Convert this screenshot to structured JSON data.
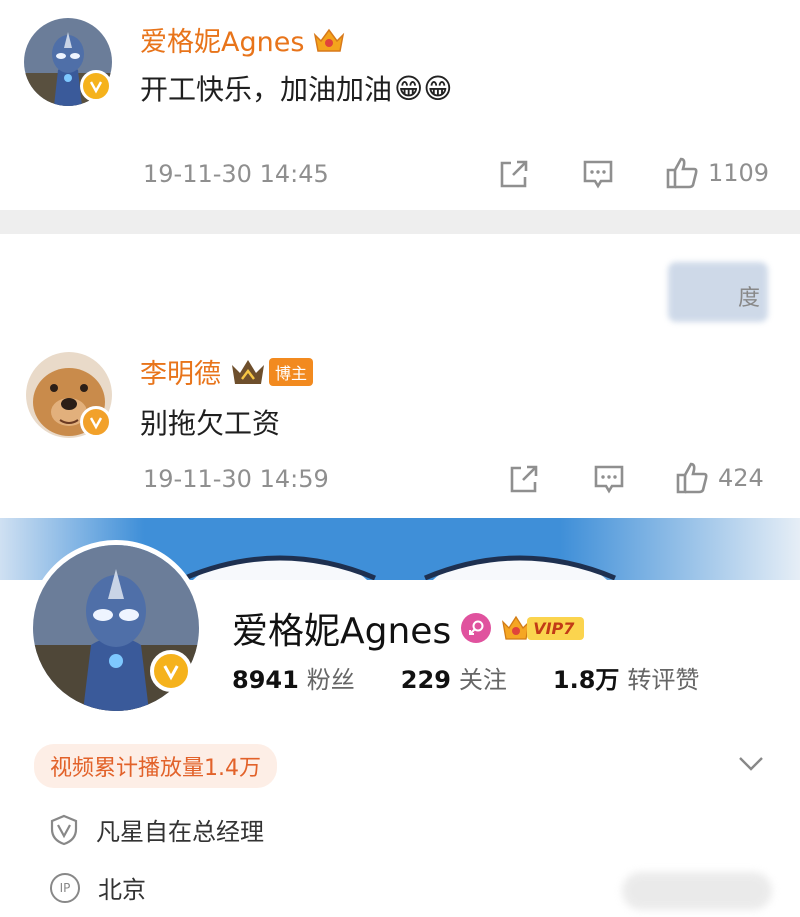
{
  "posts": [
    {
      "username": "爱格妮Agnes",
      "text": "开工快乐，加油加油",
      "emoji": "😁😁",
      "timestamp": "19-11-30 14:45",
      "likes": "1109"
    },
    {
      "username": "李明德",
      "blogger_badge": "博主",
      "text": "别拖欠工资",
      "timestamp": "19-11-30 14:59",
      "likes": "424"
    }
  ],
  "watermark": "度",
  "profile": {
    "name": "爱格妮Agnes",
    "vip_label": "VIP7",
    "followers_count": "8941",
    "followers_label": "粉丝",
    "following_count": "229",
    "following_label": "关注",
    "interactions_count": "1.8万",
    "interactions_label": "转评赞",
    "video_views_chip": "视频累计播放量1.4万",
    "verification": "凡星自在总经理",
    "ip_badge": "IP",
    "ip_location": "北京"
  },
  "colors": {
    "username": "#e8741a",
    "meta_gray": "#8f8f8f",
    "verify_gold": "#f5b21c",
    "banner_blue": "#3f8fd8",
    "chip_bg": "#fdeee6",
    "chip_text": "#e2622a",
    "female_pink": "#e0529e"
  },
  "icons": [
    "share-icon",
    "comment-icon",
    "like-icon",
    "crown-icon",
    "verified-icon",
    "female-icon",
    "chevron-down-icon",
    "shield-check-icon",
    "ip-icon"
  ]
}
